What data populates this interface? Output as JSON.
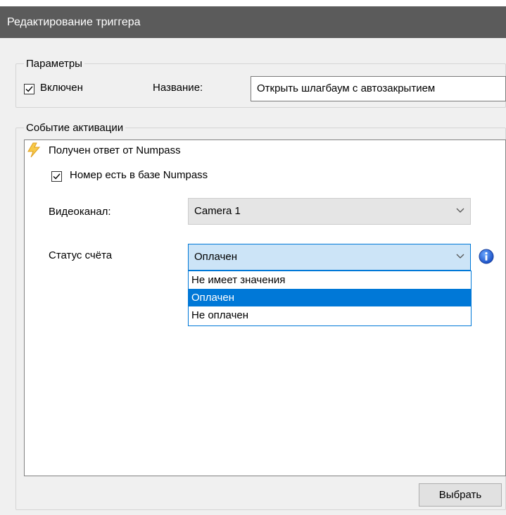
{
  "window": {
    "title": "Редактирование триггера"
  },
  "params": {
    "legend": "Параметры",
    "enabled_label": "Включен",
    "enabled_checked": true,
    "name_label": "Название:",
    "name_value": "Открыть шлагбаум с автозакрытием"
  },
  "event": {
    "legend": "Событие активации",
    "trigger_title": "Получен ответ от Numpass",
    "trigger_icon": "lightning-bolt-icon",
    "in_base_label": "Номер есть в базе Numpass",
    "in_base_checked": true,
    "video_label": "Видеоканал:",
    "video_value": "Camera 1",
    "status_label": "Статус счёта",
    "status_value": "Оплачен",
    "status_options": [
      "Не имеет значения",
      "Оплачен",
      "Не оплачен"
    ],
    "status_selected_index": 1,
    "info_icon": "info-icon"
  },
  "footer": {
    "select_button": "Выбрать"
  },
  "colors": {
    "accent": "#0078d7",
    "titlebar": "#5b5b5b",
    "selection": "#cce4f7"
  }
}
